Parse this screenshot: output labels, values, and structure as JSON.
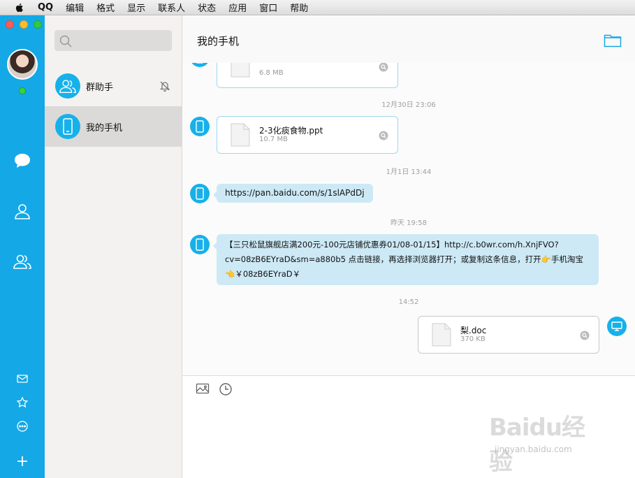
{
  "menubar": {
    "items": [
      "QQ",
      "编辑",
      "格式",
      "显示",
      "联系人",
      "状态",
      "应用",
      "窗口",
      "帮助"
    ]
  },
  "contacts": [
    {
      "name": "群助手",
      "selected": false,
      "muted": true
    },
    {
      "name": "我的手机",
      "selected": true,
      "muted": false
    }
  ],
  "chat": {
    "title": "我的手机",
    "messages": [
      {
        "type": "file",
        "side": "left",
        "name": "",
        "size": "6.8 MB"
      },
      {
        "type": "time",
        "text": "12月30日  23:06"
      },
      {
        "type": "file",
        "side": "left",
        "name": "2-3化痰食物.ppt",
        "size": "10.7 MB"
      },
      {
        "type": "time",
        "text": "1月1日  13:44"
      },
      {
        "type": "text",
        "side": "left",
        "text": "https://pan.baidu.com/s/1slAPdDj"
      },
      {
        "type": "time",
        "text": "昨天  19:58"
      },
      {
        "type": "text",
        "side": "left",
        "lines": [
          "【三只松鼠旗舰店满200元-100元店铺优惠券01/08-01/15】http://c.b0wr.com/h.XnjFVO?",
          "cv=08zB6EYraD&sm=a880b5 点击链接，再选择浏览器打开；或复制这条信息，打开👉手机淘宝",
          "👈￥08zB6EYraD￥"
        ]
      },
      {
        "type": "time",
        "text": "14:52"
      },
      {
        "type": "file",
        "side": "right",
        "name": "梨.doc",
        "size": "370 KB"
      }
    ]
  },
  "watermark": {
    "logo": "Baidu经验",
    "url": "jingyan.baidu.com"
  },
  "colors": {
    "accent": "#14a8e6",
    "bubble": "#cde9f6"
  }
}
